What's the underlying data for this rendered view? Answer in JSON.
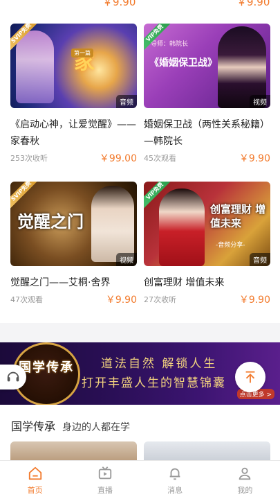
{
  "accent": "#f27a2c",
  "top_row": {
    "left_price": "￥9.90",
    "right_price": "￥9.90"
  },
  "courses": [
    {
      "badge": "SVIP免费",
      "media": "音频",
      "title": "《启动心神，让爱觉醒》——家春秋",
      "count": "253次收听",
      "price": "￥99.00",
      "cover_text": "家",
      "cover_sub": "第一篇"
    },
    {
      "badge": "VIP免费",
      "media": "视频",
      "title": "婚姻保卫战（两性关系秘籍）—韩院长",
      "count": "45次观看",
      "price": "￥9.90",
      "cover_text": "《婚姻保卫战》",
      "cover_sub": "导师：韩院长"
    },
    {
      "badge": "SVIP免费",
      "media": "视频",
      "title": "觉醒之门——艾桐·舍界",
      "count": "47次观看",
      "price": "￥9.90",
      "cover_text": "觉醒之门",
      "cover_sub": ""
    },
    {
      "badge": "VIP免费",
      "media": "音频",
      "title": "创富理财 增值未来",
      "count": "27次收听",
      "price": "￥9.90",
      "cover_text": "创富理财 增值未来",
      "cover_sub": "-音频分享-"
    }
  ],
  "banner": {
    "emblem": "国学传承",
    "line1": "道法自然  解锁人生",
    "line2": "打开丰盛人生的智慧锦囊",
    "more": "点击更多 >"
  },
  "section": {
    "title": "国学传承",
    "subtitle": "身边的人都在学"
  },
  "tabs": [
    {
      "label": "首页",
      "icon": "home-icon",
      "active": true
    },
    {
      "label": "直播",
      "icon": "live-tv-icon",
      "active": false
    },
    {
      "label": "消息",
      "icon": "bell-icon",
      "active": false
    },
    {
      "label": "我的",
      "icon": "user-icon",
      "active": false
    }
  ]
}
